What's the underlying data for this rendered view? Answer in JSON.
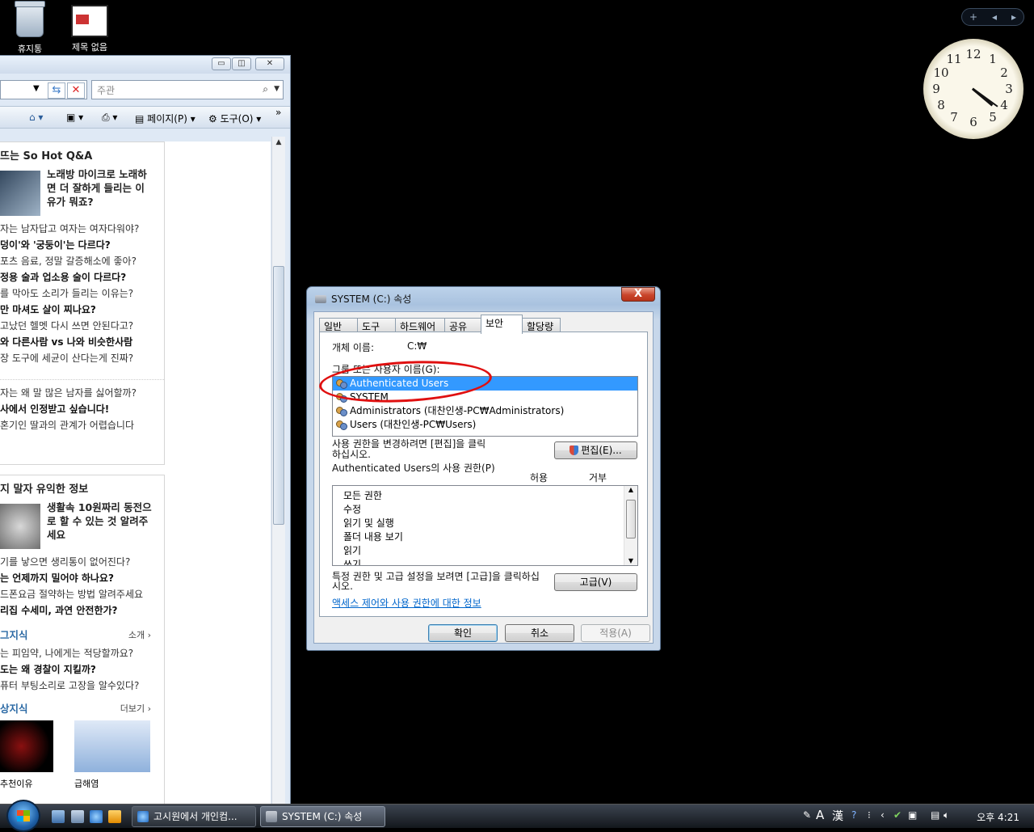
{
  "desktop": {
    "icons": [
      {
        "label": "휴지통"
      },
      {
        "label": "제목 없음"
      }
    ],
    "clock": {
      "numbers": [
        "12",
        "1",
        "2",
        "3",
        "4",
        "5",
        "6",
        "7",
        "8",
        "9",
        "10",
        "11"
      ],
      "time": "4:21"
    }
  },
  "ie": {
    "search_placeholder": "주관",
    "commands": {
      "page": "페이지(P)",
      "tools": "도구(O)"
    },
    "sections": [
      {
        "title": "뜨는 So Hot Q&A",
        "feature": "노래방 마이크로 노래하면 더 잘하게 들리는 이유가 뭐죠?",
        "lines": [
          {
            "text": "자는 남자답고 여자는 여자다워야?",
            "bold": false
          },
          {
            "text": "덩이'와 '궁둥이'는 다르다?",
            "bold": true
          },
          {
            "text": "포츠 음료, 정말 갈증해소에 좋아?",
            "bold": false
          },
          {
            "text": "정용 술과 업소용 술이 다르다?",
            "bold": true
          },
          {
            "text": "를 막아도 소리가 들리는 이유는?",
            "bold": false
          },
          {
            "text": "만 마셔도 살이 찌나요?",
            "bold": true
          },
          {
            "text": "고났던 헬멧 다시 쓰면 안된다고?",
            "bold": false
          },
          {
            "text": "와 다른사람 vs 나와 비슷한사람",
            "bold": true
          },
          {
            "text": "장 도구에 세균이 산다는게 진짜?",
            "bold": false
          }
        ],
        "lines2": [
          {
            "text": "자는 왜 말 많은 남자를 싫어할까?",
            "bold": false
          },
          {
            "text": "사에서 인정받고 싶습니다!",
            "bold": true
          },
          {
            "text": "혼기인 딸과의 관계가 어렵습니다",
            "bold": false
          }
        ]
      },
      {
        "title": "지 말자 유익한 정보",
        "feature": "생활속 10원짜리 동전으로 할 수 있는 것 알려주세요",
        "lines": [
          {
            "text": "기를 낳으면 생리통이 없어진다?",
            "bold": false
          },
          {
            "text": "는 언제까지 밀어야 하나요?",
            "bold": true
          },
          {
            "text": "드폰요금 절약하는 방법 알려주세요",
            "bold": false
          },
          {
            "text": "리집 수세미, 과연 안전한가?",
            "bold": true
          }
        ]
      },
      {
        "title": "그지식",
        "more": "소개",
        "lines": [
          {
            "text": "는 피임약, 나에게는 적당할까요?",
            "bold": false
          },
          {
            "text": "도는 왜 경찰이 지킬까?",
            "bold": true
          },
          {
            "text": "퓨터 부팅소리로 고장을 알수있다?",
            "bold": false
          }
        ]
      },
      {
        "title": "상지식",
        "more": "더보기",
        "captions": [
          "추천이유",
          "급해염"
        ]
      }
    ]
  },
  "dialog": {
    "title": "SYSTEM (C:) 속성",
    "close": "X",
    "tabs": [
      "일반",
      "도구",
      "하드웨어",
      "공유",
      "보안",
      "할당량"
    ],
    "active_tab": "보안",
    "object_name_label": "개체 이름:",
    "object_name_value": "C:₩",
    "group_label": "그룹 또는 사용자 이름(G):",
    "users": [
      {
        "name": "Authenticated Users",
        "selected": true
      },
      {
        "name": "SYSTEM",
        "selected": false
      },
      {
        "name": "Administrators (대찬인생-PC₩Administrators)",
        "selected": false
      },
      {
        "name": "Users (대찬인생-PC₩Users)",
        "selected": false
      }
    ],
    "edit_hint": "사용 권한을 변경하려면 [편집]을 클릭하십시오.",
    "edit_button": "편집(E)...",
    "perm_label": "Authenticated Users의 사용 권한(P)",
    "allow": "허용",
    "deny": "거부",
    "permissions": [
      "모든 권한",
      "수정",
      "읽기 및 실행",
      "폴더 내용 보기",
      "읽기",
      "쓰기"
    ],
    "advanced_hint": "특정 권한 및 고급 설정을 보려면 [고급]을 클릭하십시오.",
    "advanced_button": "고급(V)",
    "help_link": "액세스 제어와 사용 권한에 대한 정보",
    "ok": "확인",
    "cancel": "취소",
    "apply": "적용(A)"
  },
  "taskbar": {
    "tasks": [
      {
        "label": "고시원에서 개인컴...",
        "active": false
      },
      {
        "label": "SYSTEM (C:) 속성",
        "active": true
      }
    ],
    "tray": {
      "ime_a": "A",
      "ime_han": "漢",
      "time": "오후 4:21"
    }
  },
  "colors": {
    "selection": "#3399ff",
    "annotation": "#e01010",
    "link": "#0066cc"
  }
}
